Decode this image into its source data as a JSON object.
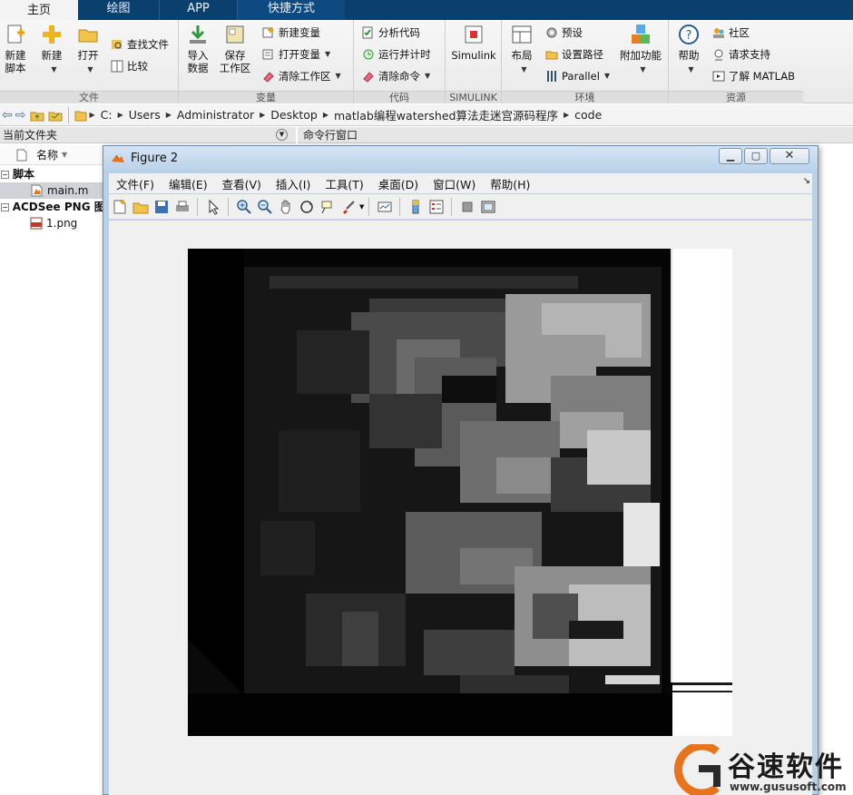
{
  "tabs": [
    {
      "label": "主页"
    },
    {
      "label": "绘图"
    },
    {
      "label": "APP"
    },
    {
      "label": "快捷方式"
    }
  ],
  "ribbon": {
    "file": {
      "label": "文件",
      "new_script": "新建\n脚本",
      "new": "新建",
      "open": "打开",
      "find_files": "查找文件",
      "compare": "比较"
    },
    "variable": {
      "label": "变量",
      "import": "导入\n数据",
      "save_ws": "保存\n工作区",
      "new_var": "新建变量",
      "open_var": "打开变量",
      "clear_ws": "清除工作区"
    },
    "code": {
      "label": "代码",
      "analyze": "分析代码",
      "run_time": "运行并计时",
      "clear_cmd": "清除命令"
    },
    "simulink": {
      "label": "SIMULINK",
      "simulink": "Simulink"
    },
    "env": {
      "label": "环境",
      "layout": "布局",
      "prefs": "预设",
      "set_path": "设置路径",
      "parallel": "Parallel",
      "addons": "附加功能"
    },
    "resources": {
      "label": "资源",
      "help": "帮助",
      "community": "社区",
      "support": "请求支持",
      "learn": "了解 MATLAB"
    }
  },
  "address": {
    "crumbs": [
      "C:",
      "Users",
      "Administrator",
      "Desktop",
      "matlab编程watershed算法走迷宫源码程序",
      "code"
    ]
  },
  "panels": {
    "current_folder": "当前文件夹",
    "command_window": "命令行窗口",
    "name_col": "名称"
  },
  "tree": {
    "group1": "脚本",
    "file1": "main.m",
    "group2": "ACDSee PNG 图像",
    "file2": "1.png"
  },
  "figure": {
    "title": "Figure 2",
    "menu": [
      "文件(F)",
      "编辑(E)",
      "查看(V)",
      "插入(I)",
      "工具(T)",
      "桌面(D)",
      "窗口(W)",
      "帮助(H)"
    ]
  },
  "watermark": {
    "brand": "谷速软件",
    "url": "www.gususoft.com"
  },
  "colors": {
    "tabbar": "#0b3f6e",
    "title_bar": "#c8dcf0",
    "accent": "#e8731c"
  }
}
